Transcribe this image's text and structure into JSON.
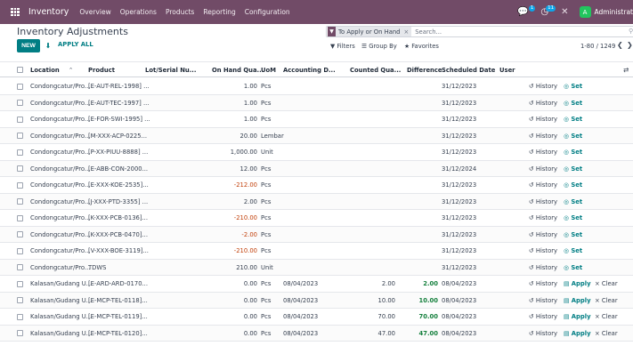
{
  "topbar": {
    "brand": "Inventory",
    "nav": [
      "Overview",
      "Operations",
      "Products",
      "Reporting",
      "Configuration"
    ],
    "chat_badge": "1",
    "activity_badge": "11",
    "avatar_letter": "A",
    "user_name": "Administrat"
  },
  "page": {
    "title": "Inventory Adjustments",
    "new_label": "NEW",
    "apply_all_label": "APPLY ALL"
  },
  "search": {
    "facet_label": "To Apply or On Hand",
    "placeholder": "Search..."
  },
  "controls": {
    "filters": "Filters",
    "group_by": "Group By",
    "favorites": "Favorites",
    "pager": "1-80 / 1249"
  },
  "columns": {
    "location": "Location",
    "product": "Product",
    "lot": "Lot/Serial Nu...",
    "on_hand": "On Hand Qua...",
    "uom": "UoM",
    "accounting_date": "Accounting D...",
    "counted": "Counted Qua...",
    "difference": "Difference",
    "scheduled": "Scheduled Date",
    "user": "User"
  },
  "actions": {
    "history": "History",
    "set": "Set",
    "apply": "Apply",
    "clear": "Clear"
  },
  "rows": [
    {
      "location": "Condongcatur/Pro...",
      "product": "[E-AUT-REL-1998] ...",
      "on_hand": "1.00",
      "neg": false,
      "uom": "Pcs",
      "acc_date": "",
      "counted": "",
      "diff": "",
      "scheduled": "31/12/2023",
      "mode": "set"
    },
    {
      "location": "Condongcatur/Pro...",
      "product": "[E-AUT-TEC-1997] ...",
      "on_hand": "1.00",
      "neg": false,
      "uom": "Pcs",
      "acc_date": "",
      "counted": "",
      "diff": "",
      "scheduled": "31/12/2023",
      "mode": "set"
    },
    {
      "location": "Condongcatur/Pro...",
      "product": "[E-FOR-SWI-1995] ...",
      "on_hand": "1.00",
      "neg": false,
      "uom": "Pcs",
      "acc_date": "",
      "counted": "",
      "diff": "",
      "scheduled": "31/12/2023",
      "mode": "set"
    },
    {
      "location": "Condongcatur/Pro...",
      "product": "[M-XXX-ACP-0225...",
      "on_hand": "20.00",
      "neg": false,
      "uom": "Lembar",
      "acc_date": "",
      "counted": "",
      "diff": "",
      "scheduled": "31/12/2023",
      "mode": "set"
    },
    {
      "location": "Condongcatur/Pro...",
      "product": "[P-XX-PIUU-8888] ...",
      "on_hand": "1,000.00",
      "neg": false,
      "uom": "Unit",
      "acc_date": "",
      "counted": "",
      "diff": "",
      "scheduled": "31/12/2023",
      "mode": "set"
    },
    {
      "location": "Condongcatur/Pro...",
      "product": "[E-ABB-CON-2000...",
      "on_hand": "12.00",
      "neg": false,
      "uom": "Pcs",
      "acc_date": "",
      "counted": "",
      "diff": "",
      "scheduled": "31/12/2024",
      "mode": "set"
    },
    {
      "location": "Condongcatur/Pro...",
      "product": "[E-XXX-KOE-2535]...",
      "on_hand": "-212.00",
      "neg": true,
      "uom": "Pcs",
      "acc_date": "",
      "counted": "",
      "diff": "",
      "scheduled": "31/12/2023",
      "mode": "set"
    },
    {
      "location": "Condongcatur/Pro...",
      "product": "[J-XXX-PTD-3355] ...",
      "on_hand": "2.00",
      "neg": false,
      "uom": "Pcs",
      "acc_date": "",
      "counted": "",
      "diff": "",
      "scheduled": "31/12/2023",
      "mode": "set"
    },
    {
      "location": "Condongcatur/Pro...",
      "product": "[K-XXX-PCB-0136]...",
      "on_hand": "-210.00",
      "neg": true,
      "uom": "Pcs",
      "acc_date": "",
      "counted": "",
      "diff": "",
      "scheduled": "31/12/2023",
      "mode": "set"
    },
    {
      "location": "Condongcatur/Pro...",
      "product": "[K-XXX-PCB-0470]...",
      "on_hand": "-2.00",
      "neg": true,
      "uom": "Pcs",
      "acc_date": "",
      "counted": "",
      "diff": "",
      "scheduled": "31/12/2023",
      "mode": "set"
    },
    {
      "location": "Condongcatur/Pro...",
      "product": "[V-XXX-BOE-3119]...",
      "on_hand": "-210.00",
      "neg": true,
      "uom": "Pcs",
      "acc_date": "",
      "counted": "",
      "diff": "",
      "scheduled": "31/12/2023",
      "mode": "set"
    },
    {
      "location": "Condongcatur/Pro...",
      "product": "TDWS",
      "on_hand": "210.00",
      "neg": false,
      "uom": "Unit",
      "acc_date": "",
      "counted": "",
      "diff": "",
      "scheduled": "31/12/2023",
      "mode": "set"
    },
    {
      "location": "Kalasan/Gudang U...",
      "product": "[E-ARD-ARD-0170...",
      "on_hand": "0.00",
      "neg": false,
      "uom": "Pcs",
      "acc_date": "08/04/2023",
      "counted": "2.00",
      "diff": "2.00",
      "scheduled": "08/04/2023",
      "mode": "apply"
    },
    {
      "location": "Kalasan/Gudang U...",
      "product": "[E-MCP-TEL-0118]...",
      "on_hand": "0.00",
      "neg": false,
      "uom": "Pcs",
      "acc_date": "08/04/2023",
      "counted": "10.00",
      "diff": "10.00",
      "scheduled": "08/04/2023",
      "mode": "apply"
    },
    {
      "location": "Kalasan/Gudang U...",
      "product": "[E-MCP-TEL-0119]...",
      "on_hand": "0.00",
      "neg": false,
      "uom": "Pcs",
      "acc_date": "08/04/2023",
      "counted": "70.00",
      "diff": "70.00",
      "scheduled": "08/04/2023",
      "mode": "apply"
    },
    {
      "location": "Kalasan/Gudang U...",
      "product": "[E-MCP-TEL-0120]...",
      "on_hand": "0.00",
      "neg": false,
      "uom": "Pcs",
      "acc_date": "08/04/2023",
      "counted": "47.00",
      "diff": "47.00",
      "scheduled": "08/04/2023",
      "mode": "apply"
    }
  ]
}
